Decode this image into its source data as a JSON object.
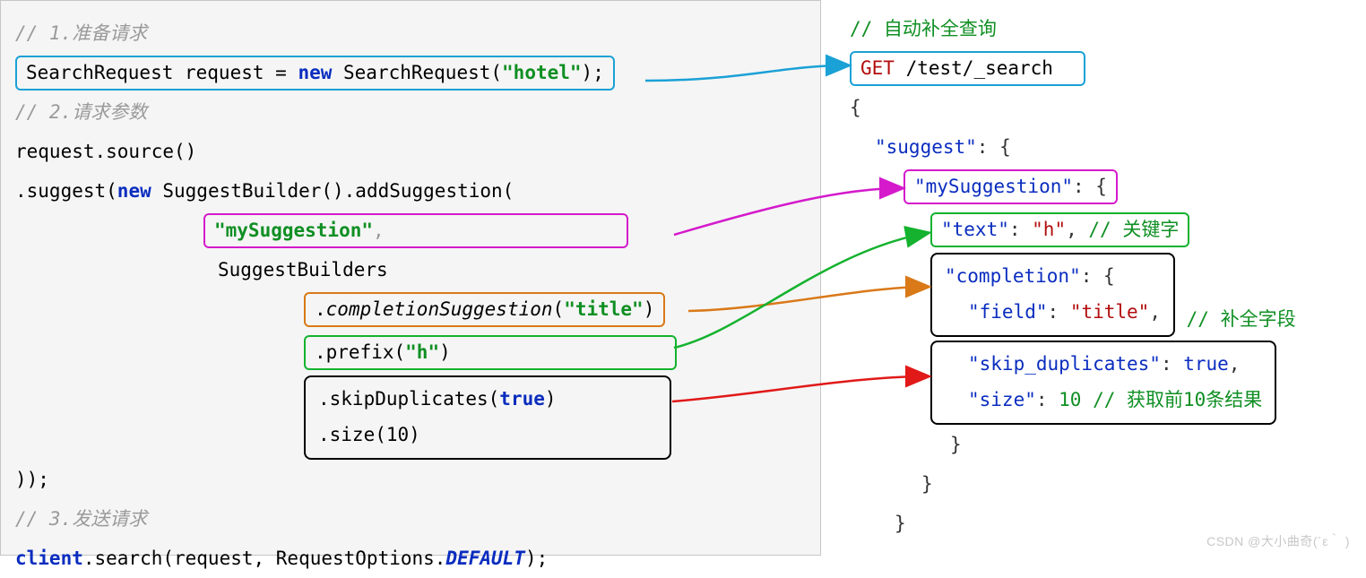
{
  "left": {
    "c1": "// 1.准备请求",
    "l1_a": "SearchRequest request = ",
    "l1_kw": "new",
    "l1_b": " SearchRequest(",
    "l1_str": "\"hotel\"",
    "l1_c": ");",
    "c2": "// 2.请求参数",
    "l2": "request.source()",
    "l3_a": "        .suggest(",
    "l3_kw": "new",
    "l3_b": " SuggestBuilder().addSuggestion(",
    "l4_str": "\"mySuggestion\"",
    "l4_c": ",",
    "l5": "SuggestBuilders",
    "l6_a": ".",
    "l6_fn": "completionSuggestion",
    "l6_b": "(",
    "l6_str": "\"title\"",
    "l6_c": ")",
    "l7_a": ".prefix(",
    "l7_str": "\"h\"",
    "l7_b": ")",
    "l8_a": ".skipDuplicates(",
    "l8_lit": "true",
    "l8_b": ")",
    "l9_a": ".size(",
    "l9_num": "10",
    "l9_b": ")",
    "l10": "        ));",
    "c3": "// 3.发送请求",
    "l11_a": "client",
    "l11_b": ".search(request, RequestOptions.",
    "l11_em": "DEFAULT",
    "l11_c": ");"
  },
  "right": {
    "c0": "// 自动补全查询",
    "get": "GET",
    "path": " /test/_search",
    "ob": "{",
    "sg_k": "\"suggest\"",
    "sg_v": ": {",
    "my_k": "\"mySuggestion\"",
    "my_v": ": {",
    "tx_k": "\"text\"",
    "tx_v": "\"h\"",
    "tx_c": " // 关键字",
    "cp_k": "\"completion\"",
    "cp_v": ": {",
    "fd_k": "\"field\"",
    "fd_v": "\"title\"",
    "fd_c": " // 补全字段",
    "sd_k": "\"skip_duplicates\"",
    "sd_v": "true",
    "sz_k": "\"size\"",
    "sz_v": "10",
    "sz_c": " // 获取前10条结果",
    "cb1": "}",
    "cb2": "}",
    "cb3": "}"
  },
  "colors": {
    "blue": "#1aa1d6",
    "magenta": "#d41acb",
    "orange": "#d97918",
    "green": "#14b22e",
    "red": "#e11919"
  },
  "watermark": "CSDN @大小曲奇(´ε｀ )"
}
